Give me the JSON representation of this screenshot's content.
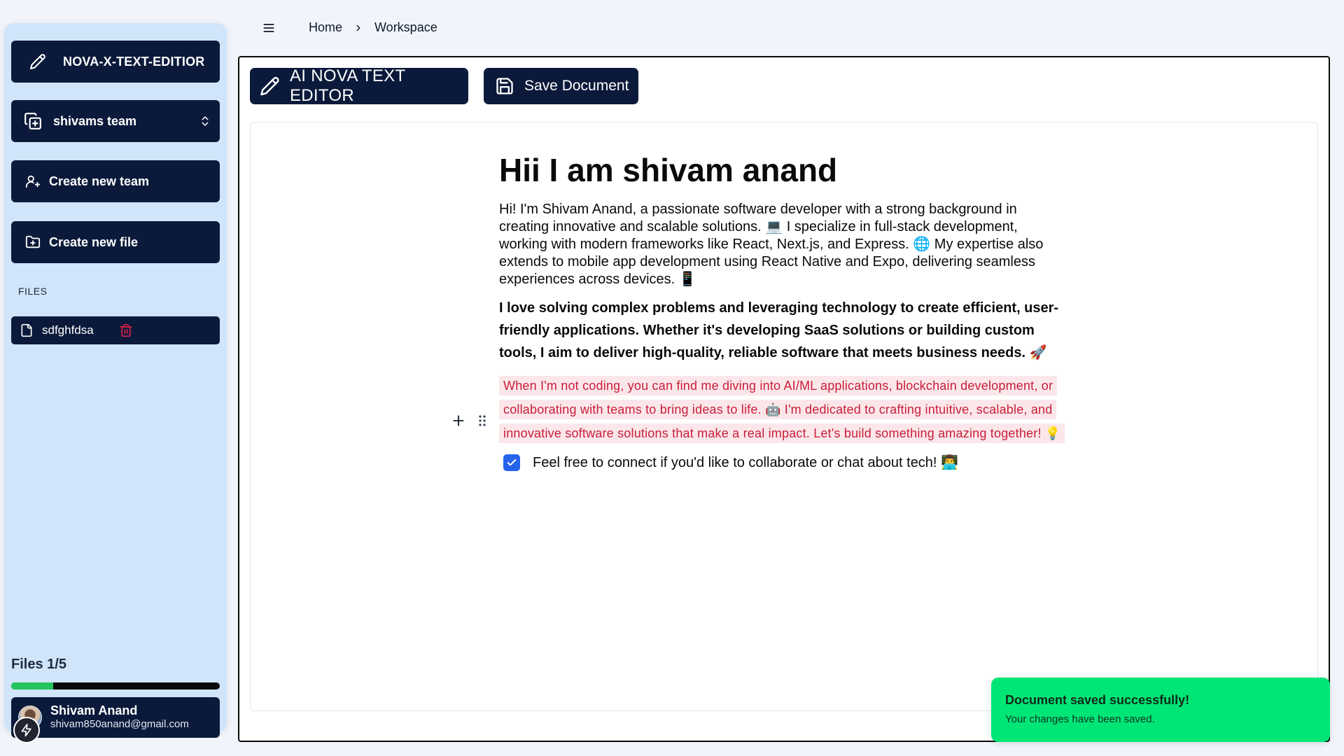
{
  "sidebar": {
    "brand_label": "NOVA-X-TEXT-EDITIOR",
    "team_label": "shivams team",
    "create_team_label": "Create new team",
    "create_file_label": "Create new file",
    "files_heading": "FILES",
    "files": [
      {
        "name": "sdfghfdsa"
      }
    ],
    "files_count_label": "Files 1/5",
    "files_used": 1,
    "files_limit": 5,
    "user": {
      "name": "Shivam Anand",
      "email": "shivam850anand@gmail.com"
    }
  },
  "header": {
    "breadcrumb": [
      "Home",
      "Workspace"
    ]
  },
  "toolbar": {
    "ai_label": "AI NOVA TEXT EDITOR",
    "save_label": "Save Document"
  },
  "document": {
    "title": "Hii I am shivam anand",
    "paragraph1": "Hi! I'm Shivam Anand, a passionate software developer with a strong background in creating innovative and scalable solutions. 💻 I specialize in full-stack development, working with modern frameworks like React, Next.js, and Express. 🌐 My expertise also extends to mobile app development using React Native and Expo, delivering seamless experiences across devices. 📱",
    "paragraph2": "I love solving complex problems and leveraging technology to create efficient, user-friendly applications. Whether it's developing SaaS solutions or building custom tools, I aim to deliver high-quality, reliable software that meets business needs. 🚀",
    "paragraph3": "When I'm not coding, you can find me diving into AI/ML applications, blockchain development, or collaborating with teams to bring ideas to life. 🤖 I'm dedicated to crafting intuitive, scalable, and innovative software solutions that make a real impact. Let's build something amazing together! 💡",
    "task_text": "Feel free to connect if you'd like to collaborate or chat about tech! 👨‍💻",
    "task_checked": true
  },
  "toast": {
    "title": "Document saved successfully!",
    "description": "Your changes have been saved."
  },
  "colors": {
    "navy": "#0b1a3a",
    "sidebar_bg": "#d0e4fa",
    "progress": "#22c55e",
    "toast": "#00e676",
    "highlight_text": "#c81e3a",
    "delete": "#e11d48"
  }
}
